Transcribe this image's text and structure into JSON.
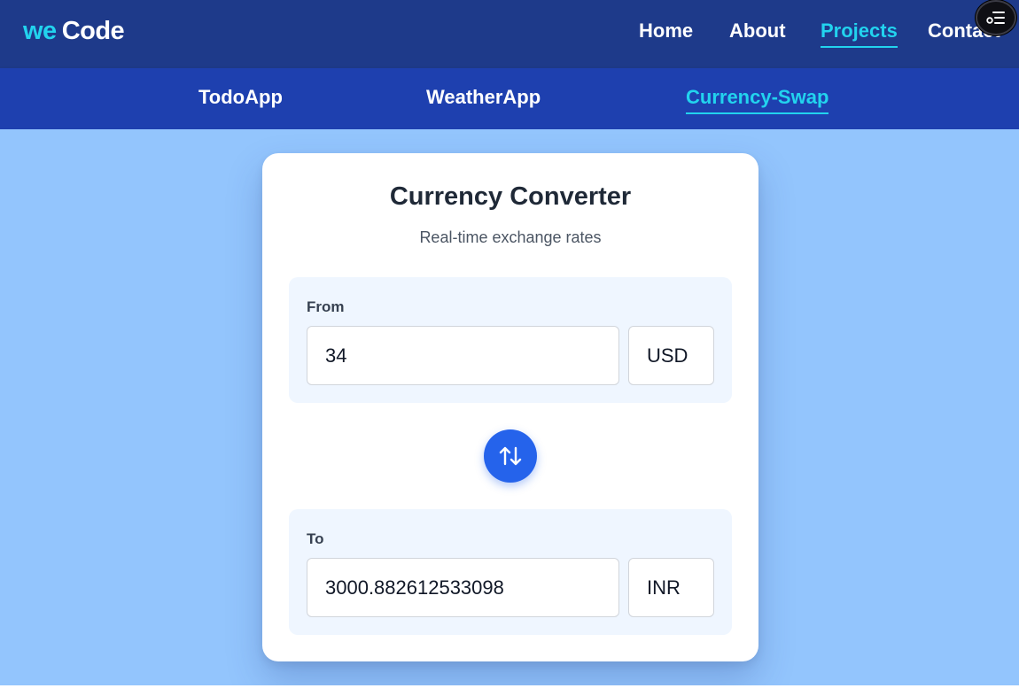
{
  "brand": {
    "prefix": "we",
    "name": "Code"
  },
  "nav": {
    "items": [
      {
        "label": "Home"
      },
      {
        "label": "About"
      },
      {
        "label": "Projects",
        "active": true
      },
      {
        "label": "Contact"
      }
    ]
  },
  "subnav": {
    "items": [
      {
        "label": "TodoApp"
      },
      {
        "label": "WeatherApp"
      },
      {
        "label": "Currency-Swap",
        "active": true
      }
    ]
  },
  "converter": {
    "title": "Currency Converter",
    "subtitle": "Real-time exchange rates",
    "from": {
      "label": "From",
      "amount": "34",
      "currency": "USD"
    },
    "to": {
      "label": "To",
      "amount": "3000.882612533098",
      "currency": "INR"
    }
  },
  "icons": {
    "menu": "menu-toggle-icon",
    "swap": "swap-arrows-icon"
  },
  "colors": {
    "topbar": "#1e3a8a",
    "subbar": "#1e40af",
    "accent": "#22d3ee",
    "background": "#93c5fd",
    "button": "#2563eb",
    "panel": "#eff6ff"
  }
}
